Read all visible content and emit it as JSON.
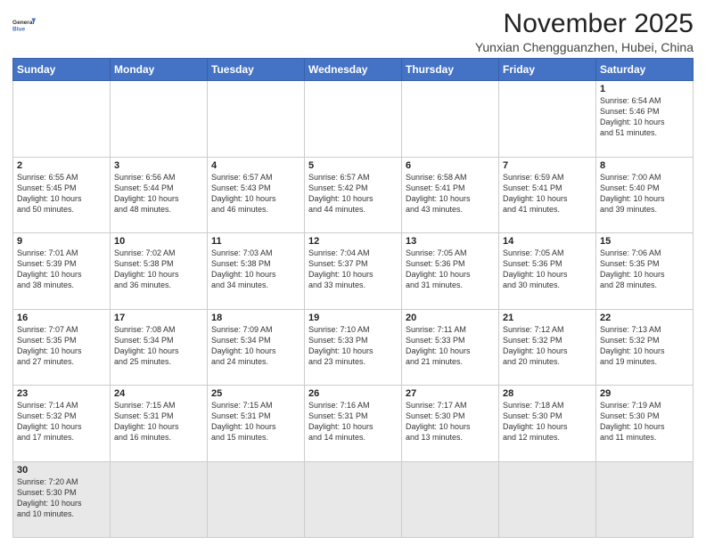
{
  "header": {
    "logo_general": "General",
    "logo_blue": "Blue",
    "month_title": "November 2025",
    "subtitle": "Yunxian Chengguanzhen, Hubei, China"
  },
  "days_of_week": [
    "Sunday",
    "Monday",
    "Tuesday",
    "Wednesday",
    "Thursday",
    "Friday",
    "Saturday"
  ],
  "weeks": [
    [
      {
        "day": "",
        "info": ""
      },
      {
        "day": "",
        "info": ""
      },
      {
        "day": "",
        "info": ""
      },
      {
        "day": "",
        "info": ""
      },
      {
        "day": "",
        "info": ""
      },
      {
        "day": "",
        "info": ""
      },
      {
        "day": "1",
        "info": "Sunrise: 6:54 AM\nSunset: 5:46 PM\nDaylight: 10 hours\nand 51 minutes."
      }
    ],
    [
      {
        "day": "2",
        "info": "Sunrise: 6:55 AM\nSunset: 5:45 PM\nDaylight: 10 hours\nand 50 minutes."
      },
      {
        "day": "3",
        "info": "Sunrise: 6:56 AM\nSunset: 5:44 PM\nDaylight: 10 hours\nand 48 minutes."
      },
      {
        "day": "4",
        "info": "Sunrise: 6:57 AM\nSunset: 5:43 PM\nDaylight: 10 hours\nand 46 minutes."
      },
      {
        "day": "5",
        "info": "Sunrise: 6:57 AM\nSunset: 5:42 PM\nDaylight: 10 hours\nand 44 minutes."
      },
      {
        "day": "6",
        "info": "Sunrise: 6:58 AM\nSunset: 5:41 PM\nDaylight: 10 hours\nand 43 minutes."
      },
      {
        "day": "7",
        "info": "Sunrise: 6:59 AM\nSunset: 5:41 PM\nDaylight: 10 hours\nand 41 minutes."
      },
      {
        "day": "8",
        "info": "Sunrise: 7:00 AM\nSunset: 5:40 PM\nDaylight: 10 hours\nand 39 minutes."
      }
    ],
    [
      {
        "day": "9",
        "info": "Sunrise: 7:01 AM\nSunset: 5:39 PM\nDaylight: 10 hours\nand 38 minutes."
      },
      {
        "day": "10",
        "info": "Sunrise: 7:02 AM\nSunset: 5:38 PM\nDaylight: 10 hours\nand 36 minutes."
      },
      {
        "day": "11",
        "info": "Sunrise: 7:03 AM\nSunset: 5:38 PM\nDaylight: 10 hours\nand 34 minutes."
      },
      {
        "day": "12",
        "info": "Sunrise: 7:04 AM\nSunset: 5:37 PM\nDaylight: 10 hours\nand 33 minutes."
      },
      {
        "day": "13",
        "info": "Sunrise: 7:05 AM\nSunset: 5:36 PM\nDaylight: 10 hours\nand 31 minutes."
      },
      {
        "day": "14",
        "info": "Sunrise: 7:05 AM\nSunset: 5:36 PM\nDaylight: 10 hours\nand 30 minutes."
      },
      {
        "day": "15",
        "info": "Sunrise: 7:06 AM\nSunset: 5:35 PM\nDaylight: 10 hours\nand 28 minutes."
      }
    ],
    [
      {
        "day": "16",
        "info": "Sunrise: 7:07 AM\nSunset: 5:35 PM\nDaylight: 10 hours\nand 27 minutes."
      },
      {
        "day": "17",
        "info": "Sunrise: 7:08 AM\nSunset: 5:34 PM\nDaylight: 10 hours\nand 25 minutes."
      },
      {
        "day": "18",
        "info": "Sunrise: 7:09 AM\nSunset: 5:34 PM\nDaylight: 10 hours\nand 24 minutes."
      },
      {
        "day": "19",
        "info": "Sunrise: 7:10 AM\nSunset: 5:33 PM\nDaylight: 10 hours\nand 23 minutes."
      },
      {
        "day": "20",
        "info": "Sunrise: 7:11 AM\nSunset: 5:33 PM\nDaylight: 10 hours\nand 21 minutes."
      },
      {
        "day": "21",
        "info": "Sunrise: 7:12 AM\nSunset: 5:32 PM\nDaylight: 10 hours\nand 20 minutes."
      },
      {
        "day": "22",
        "info": "Sunrise: 7:13 AM\nSunset: 5:32 PM\nDaylight: 10 hours\nand 19 minutes."
      }
    ],
    [
      {
        "day": "23",
        "info": "Sunrise: 7:14 AM\nSunset: 5:32 PM\nDaylight: 10 hours\nand 17 minutes."
      },
      {
        "day": "24",
        "info": "Sunrise: 7:15 AM\nSunset: 5:31 PM\nDaylight: 10 hours\nand 16 minutes."
      },
      {
        "day": "25",
        "info": "Sunrise: 7:15 AM\nSunset: 5:31 PM\nDaylight: 10 hours\nand 15 minutes."
      },
      {
        "day": "26",
        "info": "Sunrise: 7:16 AM\nSunset: 5:31 PM\nDaylight: 10 hours\nand 14 minutes."
      },
      {
        "day": "27",
        "info": "Sunrise: 7:17 AM\nSunset: 5:30 PM\nDaylight: 10 hours\nand 13 minutes."
      },
      {
        "day": "28",
        "info": "Sunrise: 7:18 AM\nSunset: 5:30 PM\nDaylight: 10 hours\nand 12 minutes."
      },
      {
        "day": "29",
        "info": "Sunrise: 7:19 AM\nSunset: 5:30 PM\nDaylight: 10 hours\nand 11 minutes."
      }
    ],
    [
      {
        "day": "30",
        "info": "Sunrise: 7:20 AM\nSunset: 5:30 PM\nDaylight: 10 hours\nand 10 minutes."
      },
      {
        "day": "",
        "info": ""
      },
      {
        "day": "",
        "info": ""
      },
      {
        "day": "",
        "info": ""
      },
      {
        "day": "",
        "info": ""
      },
      {
        "day": "",
        "info": ""
      },
      {
        "day": "",
        "info": ""
      }
    ]
  ]
}
